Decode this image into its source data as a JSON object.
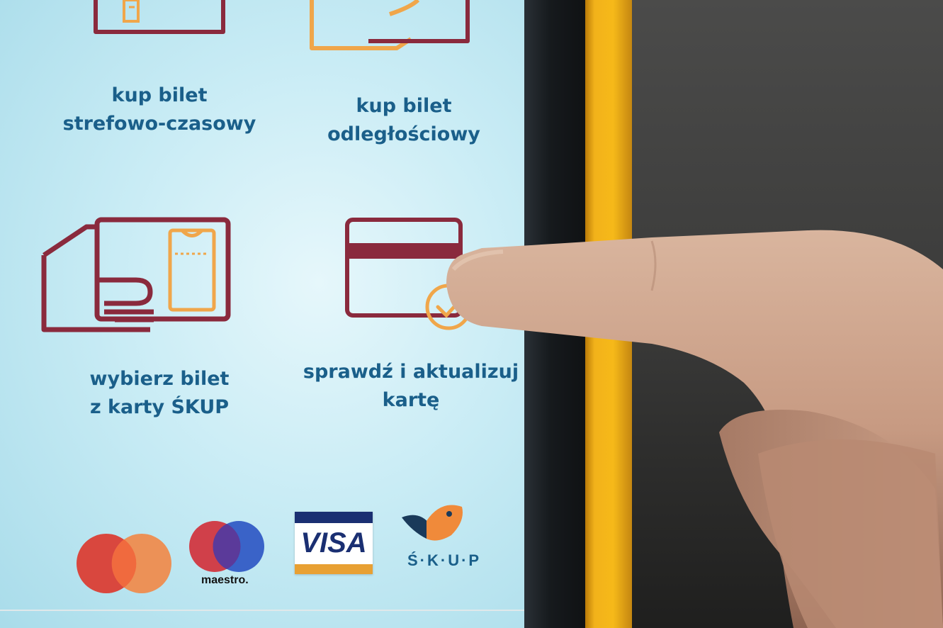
{
  "tiles": [
    {
      "label_lines": [
        "kup bilet",
        "strefowo-czasowy"
      ],
      "icon": "ticket-hand-icon"
    },
    {
      "label_lines": [
        "kup bilet",
        "odległościowy"
      ],
      "icon": "hand-card-icon"
    },
    {
      "label_lines": [
        "wybierz bilet",
        "z karty ŚKUP"
      ],
      "icon": "card-ticket-hand-icon"
    },
    {
      "label_lines": [
        "sprawdź i aktualizuj",
        "kartę"
      ],
      "icon": "card-check-icon"
    }
  ],
  "payment_logos": {
    "mastercard": "mastercard-logo",
    "maestro": "maestro.",
    "visa": "VISA",
    "skup": "Ś·K·U·P"
  },
  "colors": {
    "screen_bg": "#c9ecf5",
    "label_text": "#1a5f8a",
    "icon_maroon": "#8a2a3d",
    "icon_orange": "#f0a64a",
    "frame_yellow": "#f6b919"
  }
}
